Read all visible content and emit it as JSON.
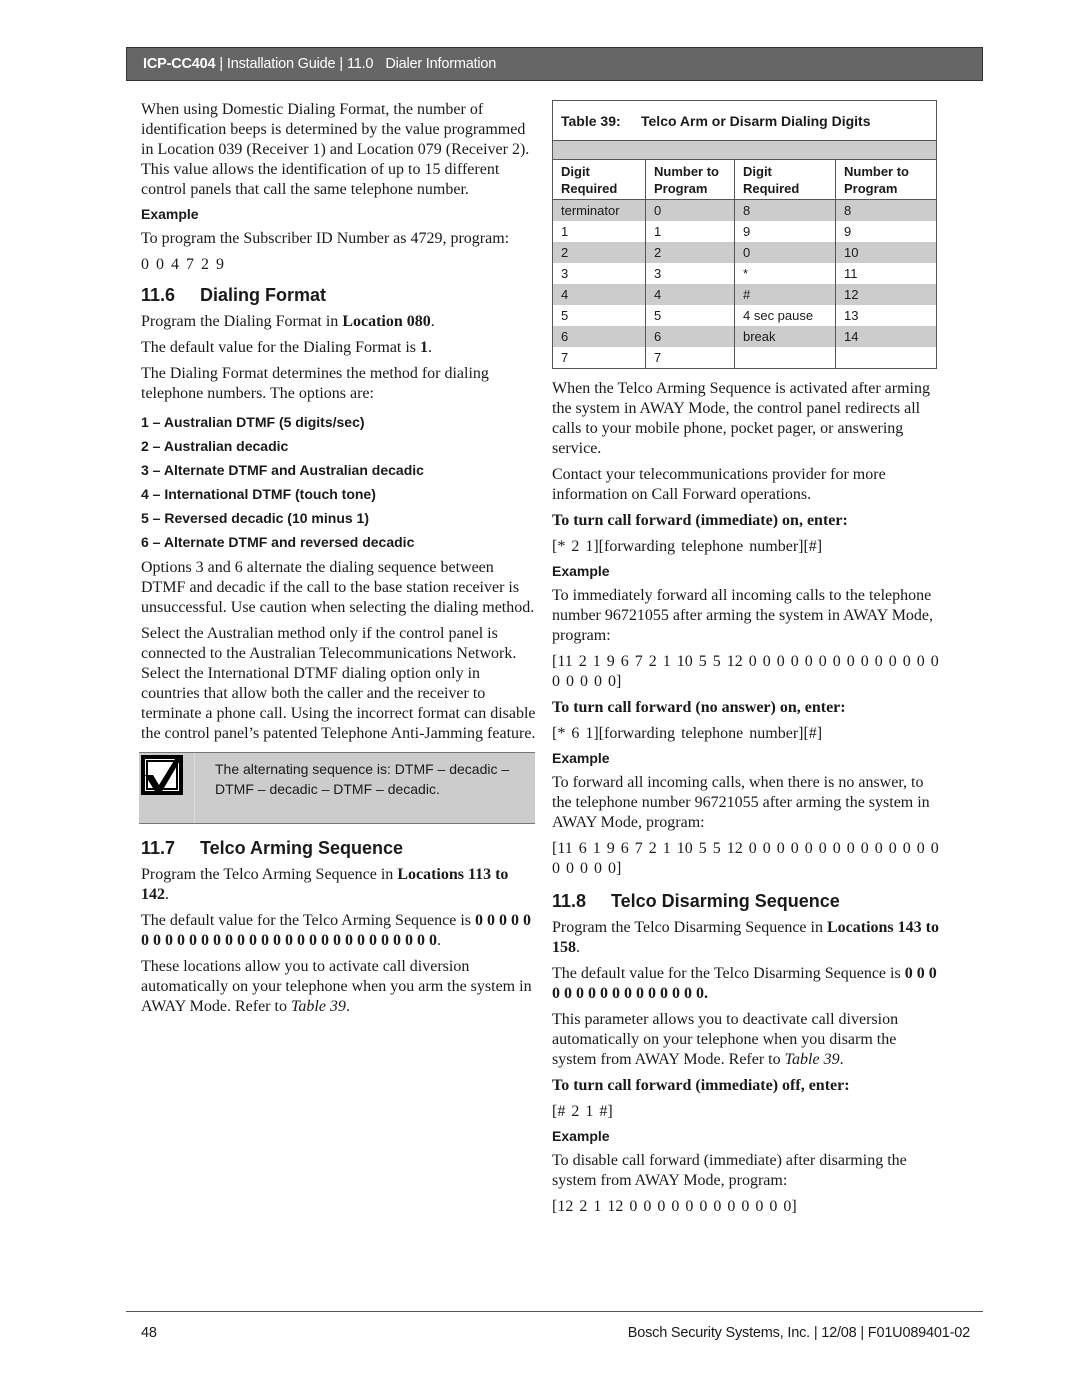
{
  "header": {
    "product": "ICP-CC404",
    "separator": "|",
    "guide": "Installation Guide",
    "section_number": "11.0",
    "section_title": "Dialer Information"
  },
  "left": {
    "intro_paragraph": "When using Domestic Dialing Format, the number of identification beeps is determined by the value programmed in Location 039 (Receiver 1) and Location 079 (Receiver 2). This value allows the identification of up to 15 different control panels that call the same telephone number.",
    "example_label": "Example",
    "example_text": "To program the Subscriber ID Number as 4729, program:",
    "example_code": "0  0  4  7  2  9",
    "s116": {
      "number": "11.6",
      "title": "Dialing Format",
      "p1_pre": "Program the Dialing Format in ",
      "p1_bold": "Location 080",
      "p1_post": ".",
      "p2_pre": "The default value for the Dialing Format is ",
      "p2_bold": "1",
      "p2_post": ".",
      "p3": "The Dialing Format determines the method for dialing telephone numbers. The options are:",
      "options": [
        "1 – Australian DTMF (5 digits/sec)",
        "2 – Australian decadic",
        "3 – Alternate DTMF and Australian decadic",
        "4 – International DTMF (touch tone)",
        "5 – Reversed decadic (10 minus 1)",
        "6 – Alternate DTMF and reversed decadic"
      ],
      "p4": "Options 3 and 6 alternate the dialing sequence between DTMF and decadic if the call to the base station receiver is unsuccessful. Use caution when selecting the dialing method.",
      "p5": "Select the Australian method only if the control panel is connected to the Australian Telecommunications Network. Select the International DTMF dialing option only in countries that allow both the caller and the receiver to terminate a phone call. Using the incorrect format can disable the control panel’s patented Telephone Anti-Jamming feature.",
      "note": "The alternating sequence is: DTMF – decadic – DTMF – decadic – DTMF – decadic."
    },
    "s117": {
      "number": "11.7",
      "title": "Telco Arming Sequence",
      "p1_pre": "Program the Telco Arming Sequence in ",
      "p1_bold": "Locations 113 to 142",
      "p1_post": ".",
      "p2_pre": "The default value for the Telco Arming Sequence is ",
      "p2_bold": "0 0 0 0 0 0 0 0 0 0 0 0 0 0 0 0 0 0 0 0 0 0 0 0 0 0 0 0 0 0",
      "p2_post": ".",
      "p3_pre": "These locations allow you to activate call diversion automatically on your telephone when you arm the system in AWAY Mode. Refer to ",
      "p3_italic": "Table 39",
      "p3_post": "."
    }
  },
  "table39": {
    "label": "Table 39:",
    "title": "Telco Arm or Disarm Dialing Digits",
    "columns": [
      "Digit Required",
      "Number to Program",
      "Digit Required",
      "Number to Program"
    ],
    "rows": [
      [
        "terminator",
        "0",
        "8",
        "8"
      ],
      [
        "1",
        "1",
        "9",
        "9"
      ],
      [
        "2",
        "2",
        "0",
        "10"
      ],
      [
        "3",
        "3",
        "*",
        "11"
      ],
      [
        "4",
        "4",
        "#",
        "12"
      ],
      [
        "5",
        "5",
        "4 sec pause",
        "13"
      ],
      [
        "6",
        "6",
        "break",
        "14"
      ],
      [
        "7",
        "7",
        "",
        ""
      ]
    ]
  },
  "right": {
    "p1": "When the Telco Arming Sequence is activated after arming the system in AWAY Mode, the control panel redirects all calls to your mobile phone, pocket pager, or answering service.",
    "p2": "Contact your telecommunications provider for more information on Call Forward operations.",
    "cf_immediate_on_heading": "To turn call forward (immediate) on, enter:",
    "cf_immediate_on_code": "[* 2 1][forwarding telephone number][#]",
    "example_label": "Example",
    "cf_immediate_on_example": "To immediately forward all incoming calls to the telephone number 96721055 after arming the system in AWAY Mode, program:",
    "cf_immediate_on_example_code": "[11  2 1 9 6 7 2 1  10  5 5  12  0 0 0 0 0 0 0 0 0 0 0 0 0 0 0 0 0 0 0]",
    "cf_noanswer_on_heading": "To turn call forward (no answer) on, enter:",
    "cf_noanswer_on_code": "[* 6 1][forwarding telephone number][#]",
    "cf_noanswer_on_example": "To forward all incoming calls, when there is no answer, to the telephone number 96721055 after arming the system in AWAY Mode, program:",
    "cf_noanswer_on_example_code": "[11  6 1 9 6 7 2 1  10  5 5  12  0 0 0 0 0 0 0 0 0 0 0 0 0 0 0 0 0 0 0]",
    "s118": {
      "number": "11.8",
      "title": "Telco Disarming Sequence",
      "p1_pre": "Program the Telco Disarming Sequence in ",
      "p1_bold": "Locations 143 to 158",
      "p1_post": ".",
      "p2_pre": "The default value for the Telco Disarming Sequence is ",
      "p2_bold": "0 0 0 0 0 0 0 0 0 0 0 0 0 0 0 0.",
      "p3_pre": "This parameter allows you to deactivate call diversion automatically on your telephone when you disarm the system from AWAY Mode. Refer to ",
      "p3_italic": "Table 39",
      "p3_post": ".",
      "cf_off_heading": "To turn call forward (immediate) off, enter:",
      "cf_off_code": "[# 2 1 #]",
      "cf_off_example": "To disable call forward (immediate) after disarming the system from AWAY Mode, program:",
      "cf_off_example_code": "[12  2  1  12  0 0 0 0 0 0 0 0 0 0 0 0]"
    }
  },
  "footer": {
    "page_number": "48",
    "company": "Bosch Security Systems, Inc.",
    "date": "12/08",
    "doc_id": "F01U089401-02",
    "separator": "|"
  }
}
